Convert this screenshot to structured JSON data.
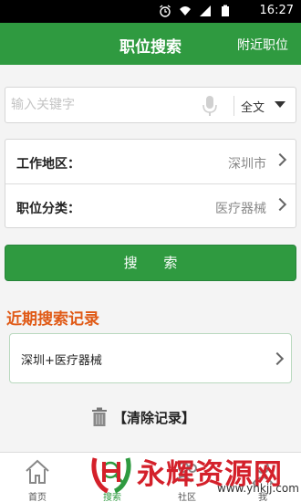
{
  "statusbar": {
    "time": "16:27",
    "icons": [
      "alarm-icon",
      "wifi-icon",
      "signal-icon",
      "battery-icon"
    ]
  },
  "header": {
    "title": "职位搜索",
    "nearby_label": "附近职位"
  },
  "search": {
    "placeholder": "输入关键字",
    "value": "",
    "scope_label": "全文"
  },
  "filters": [
    {
      "label": "工作地区：",
      "value": "深圳市"
    },
    {
      "label": "职位分类：",
      "value": "医疗器械"
    }
  ],
  "search_button_label": "搜 索",
  "recent": {
    "title": "近期搜索记录",
    "items": [
      {
        "label": "深圳+医疗器械"
      }
    ],
    "clear_label": "【清除记录】"
  },
  "tabbar": {
    "tabs": [
      {
        "label": "首页",
        "icon": "home-icon",
        "active": false
      },
      {
        "label": "搜索",
        "icon": "search-icon",
        "active": true
      },
      {
        "label": "社区",
        "icon": "community-icon",
        "active": false
      },
      {
        "label": "我",
        "icon": "user-icon",
        "active": false
      }
    ]
  },
  "watermark": {
    "brand": "永辉资源网",
    "url": "www.yhkjj.com"
  },
  "colors": {
    "primary": "#2f9a40",
    "accent": "#e05a16",
    "watermark": "#d4202a"
  }
}
